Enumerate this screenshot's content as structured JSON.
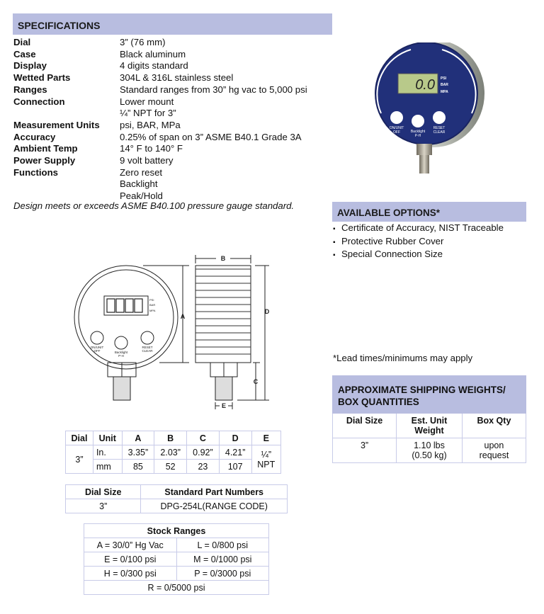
{
  "specifications": {
    "title": "SPECIFICATIONS",
    "rows": [
      {
        "label": "Dial",
        "values": [
          "3” (76 mm)"
        ]
      },
      {
        "label": "Case",
        "values": [
          "Black aluminum"
        ]
      },
      {
        "label": "Display",
        "values": [
          "4 digits standard"
        ]
      },
      {
        "label": "Wetted Parts",
        "values": [
          "304L & 316L stainless steel"
        ]
      },
      {
        "label": "Ranges",
        "values": [
          "Standard ranges from 30” hg vac to 5,000 psi"
        ]
      },
      {
        "label": "Connection",
        "values": [
          "Lower mount",
          "¼” NPT for 3”"
        ]
      },
      {
        "label": "Measurement Units",
        "values": [
          "psi, BAR, MPa"
        ]
      },
      {
        "label": "Accuracy",
        "values": [
          "0.25% of span on 3” ASME B40.1 Grade 3A"
        ]
      },
      {
        "label": "Ambient Temp",
        "values": [
          "14° F to 140° F"
        ]
      },
      {
        "label": "Power Supply",
        "values": [
          "9 volt battery"
        ]
      },
      {
        "label": "Functions",
        "values": [
          "Zero reset",
          "Backlight",
          "Peak/Hold"
        ]
      }
    ],
    "note": "Design meets or exceeds ASME B40.100 pressure gauge standard."
  },
  "photo": {
    "display_value": "0.0",
    "units": [
      "PSI",
      "BAR",
      "MPA"
    ],
    "buttons": [
      {
        "label1": "ON/UNIT",
        "label2": "OFF"
      },
      {
        "label1": "Backlight",
        "label2": "P-H"
      },
      {
        "label1": "RESET",
        "label2": "CLEAR"
      }
    ]
  },
  "drawing": {
    "dim_labels": [
      "A",
      "B",
      "C",
      "D",
      "E"
    ],
    "units": [
      "PSI",
      "BAR",
      "MPA"
    ],
    "buttons": [
      {
        "label1": "ON/UNIT",
        "label2": "OFF"
      },
      {
        "label1": "Backlight",
        "label2": "P-H"
      },
      {
        "label1": "RESET",
        "label2": "CLEAR"
      }
    ]
  },
  "options": {
    "title": "AVAILABLE OPTIONS*",
    "items": [
      "Certificate of Accuracy, NIST Traceable",
      "Protective Rubber Cover",
      "Special Connection Size"
    ],
    "lead_note": "*Lead times/minimums may apply"
  },
  "shipping": {
    "title_line1": "APPROXIMATE SHIPPING WEIGHTS/",
    "title_line2": "BOX QUANTITIES",
    "headers": [
      "Dial Size",
      "Est. Unit Weight",
      "Box Qty"
    ],
    "row": {
      "dial": "3”",
      "weight1": "1.10 lbs",
      "weight2": "(0.50 kg)",
      "qty1": "upon",
      "qty2": "request"
    }
  },
  "dimensions": {
    "headers": [
      "Dial",
      "Unit",
      "A",
      "B",
      "C",
      "D",
      "E"
    ],
    "dial": "3”",
    "rows": [
      {
        "unit": "In.",
        "A": "3.35”",
        "B": "2.03”",
        "C": "0.92”",
        "D": "4.21”"
      },
      {
        "unit": "mm",
        "A": "85",
        "B": "52",
        "C": "23",
        "D": "107"
      }
    ],
    "E1": "¼”",
    "E2": "NPT"
  },
  "parts": {
    "headers": [
      "Dial Size",
      "Standard Part Numbers"
    ],
    "row": [
      "3”",
      "DPG-254L(RANGE CODE)"
    ]
  },
  "stock_ranges": {
    "title": "Stock Ranges",
    "rows": [
      [
        "A = 30/0” Hg Vac",
        "L = 0/800 psi"
      ],
      [
        "E = 0/100 psi",
        "M = 0/1000 psi"
      ],
      [
        "H = 0/300 psi",
        "P = 0/3000 psi"
      ]
    ],
    "last": "R = 0/5000 psi"
  }
}
